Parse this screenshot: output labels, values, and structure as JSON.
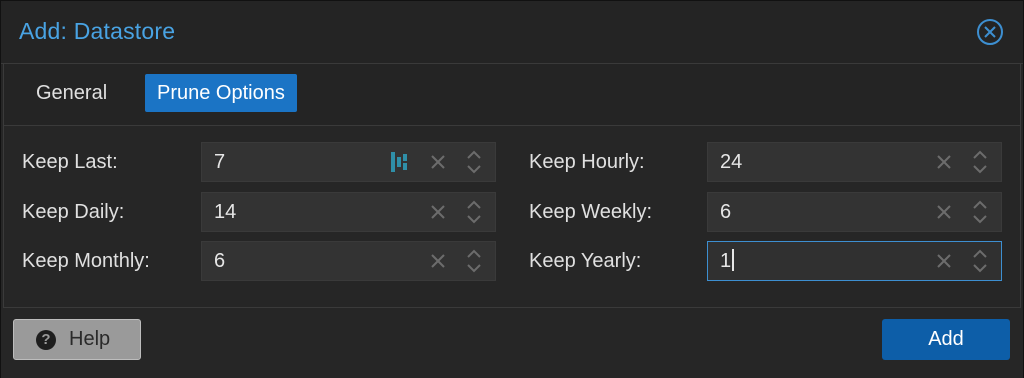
{
  "dialog": {
    "title": "Add: Datastore",
    "close_icon": "close-circle-icon"
  },
  "tabs": [
    {
      "label": "General",
      "active": false
    },
    {
      "label": "Prune Options",
      "active": true
    }
  ],
  "fields": [
    {
      "label": "Keep Last:",
      "value": "7",
      "focused": false,
      "password_manager_icon": true
    },
    {
      "label": "Keep Hourly:",
      "value": "24",
      "focused": false
    },
    {
      "label": "Keep Daily:",
      "value": "14",
      "focused": false
    },
    {
      "label": "Keep Weekly:",
      "value": "6",
      "focused": false
    },
    {
      "label": "Keep Monthly:",
      "value": "6",
      "focused": false
    },
    {
      "label": "Keep Yearly:",
      "value": "1",
      "focused": true
    }
  ],
  "footer": {
    "help_label": "Help",
    "help_icon": "question-circle-icon",
    "add_label": "Add"
  },
  "colors": {
    "accent": "#1b74c5",
    "title": "#49a3e3",
    "primary_button": "#0d5ea8",
    "background": "#262626"
  }
}
